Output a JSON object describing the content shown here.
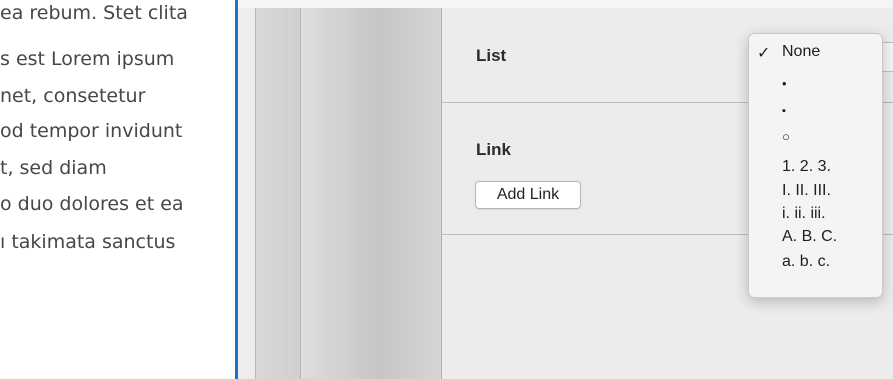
{
  "left_text": {
    "lines": [
      "ea rebum. Stet clita",
      "s est Lorem ipsum",
      "net, consetetur",
      "od tempor invidunt",
      "t, sed diam",
      "o duo dolores et ea",
      "ı takimata sanctus"
    ]
  },
  "inspector": {
    "list_label": "List",
    "link_label": "Link",
    "add_link_button": "Add Link"
  },
  "list_menu": {
    "checkmark": "✓",
    "items": [
      "None",
      "•",
      "▪",
      "○",
      "1. 2. 3.",
      "I. II. III.",
      "i. ii. iii.",
      "A. B. C.",
      "a. b. c."
    ],
    "selected": "None"
  },
  "colors": {
    "accent_rule": "#1f73c7",
    "text": "#44474b",
    "inspector_bg": "#ececec"
  }
}
